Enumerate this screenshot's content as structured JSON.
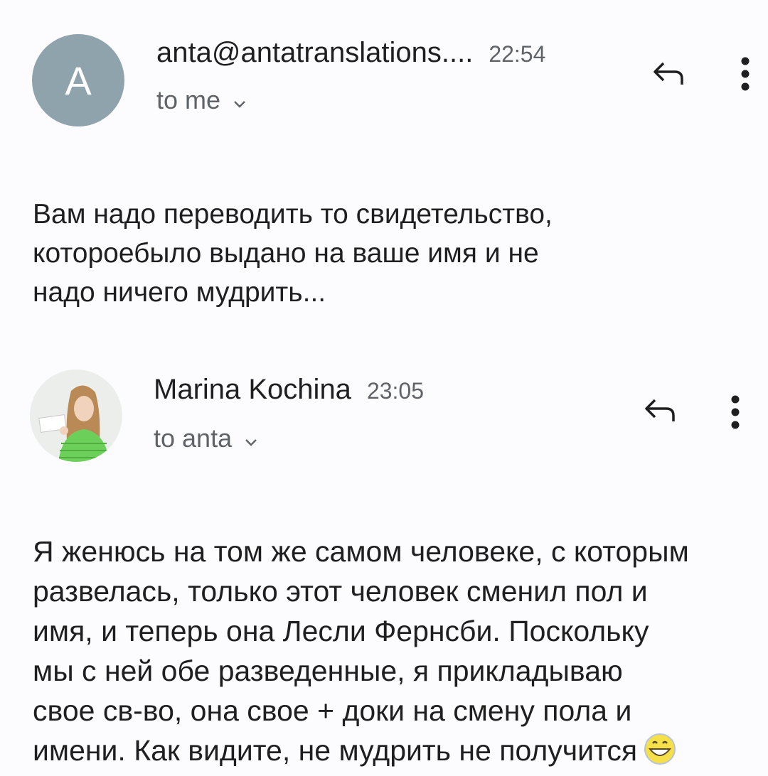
{
  "messages": [
    {
      "sender": "anta@antatranslations....",
      "time": "22:54",
      "recipient": "to me",
      "avatar_letter": "A",
      "avatar_color": "#8fa3ad",
      "body": "Вам  надо переводить то свидетельство,\nкотороебыло  выдано на ваше имя  и не\nнадо ничего мудрить..."
    },
    {
      "sender": "Marina Kochina",
      "time": "23:05",
      "recipient": "to anta",
      "avatar": "profile-photo",
      "body": "Я женюсь на том же самом человеке, с которым\nразвелась, только этот человек сменил пол и\nимя, и теперь она Лесли Фернсби. Поскольку\nмы с ней обе разведенные, я прикладываю\nсвое св-во, она свое + доки на смену пола и\nимени. Как видите, не мудрить не получится",
      "trailing_emoji": "grinning-face-emoji"
    }
  ],
  "icons": {
    "reply": "reply-arrow-icon",
    "more": "more-vertical-icon",
    "chevron": "chevron-down-icon"
  },
  "colors": {
    "background": "#fcfcfe",
    "text_primary": "#1f1f1f",
    "text_secondary": "#5f6368"
  }
}
